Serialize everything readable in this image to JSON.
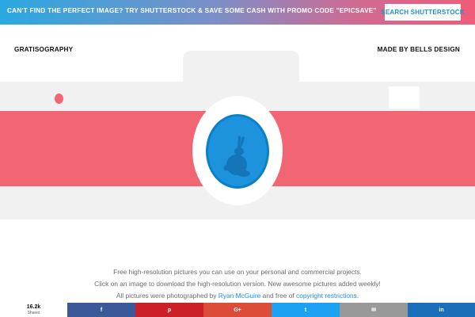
{
  "promo": {
    "text": "CAN'T FIND THE PERFECT IMAGE? TRY SHUTTERSTOCK & SAVE SOME CASH WITH PROMO CODE \"EPICSAVE\"",
    "button_label": "SEARCH SHUTTERSTOCK"
  },
  "header": {
    "brand": "GRATISOGRAPHY",
    "made_by": "MADE BY BELLS DESIGN"
  },
  "hero": {
    "icons": [
      "camera-illustration",
      "rabbit-icon"
    ],
    "colors": {
      "stripe": "#f26673",
      "body": "#f1f1f1",
      "lens": "#1d93de"
    }
  },
  "description": {
    "line1": "Free high-resolution pictures you can use on your personal and commercial projects.",
    "line2": "Click on an image to download the high-resolution version. New awesome pictures added weekly!",
    "line3_prefix": "All pictures were photographed by ",
    "photographer": "Ryan McGuire",
    "line3_middle": " and free of ",
    "copyright_link": "copyright restrictions",
    "line3_suffix": "."
  },
  "share": {
    "count": "16.2k",
    "count_label": "Shares",
    "buttons": [
      {
        "network": "facebook",
        "icon": "f",
        "color": "#3b5998"
      },
      {
        "network": "pinterest",
        "icon": "p",
        "color": "#cb2027"
      },
      {
        "network": "google-plus",
        "icon": "G+",
        "color": "#dd4b39"
      },
      {
        "network": "twitter",
        "icon": "t",
        "color": "#1da1f2"
      },
      {
        "network": "email",
        "icon": "✉",
        "color": "#999999"
      },
      {
        "network": "linkedin",
        "icon": "in",
        "color": "#1b6fb8"
      }
    ]
  }
}
